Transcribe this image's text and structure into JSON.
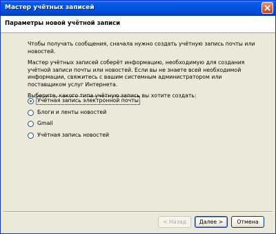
{
  "window": {
    "title": "Мастер учётных записей"
  },
  "header": {
    "title": "Параметры новой учётной записи"
  },
  "intro": {
    "p1": "Чтобы получать сообщения, сначала нужно создать учётную запись почты или новостей.",
    "p2": "Мастер учётных записей соберёт информацию, необходимую для создания учётной записи почты или новостей. Если вы не знаете всей необходимой информации, свяжитесь с вашим системным администратором или поставщиком услуг Интернета.",
    "p3": "Выберите, какого типа учётную запись вы хотите создать:"
  },
  "options": [
    {
      "label": "Учётная запись электронной почты",
      "selected": true
    },
    {
      "label": "Блоги и ленты новостей",
      "selected": false
    },
    {
      "label": "Gmail",
      "selected": false
    },
    {
      "label": "Учётная запись новостей",
      "selected": false
    }
  ],
  "buttons": {
    "back": "< Назад",
    "next": "Далее >",
    "cancel": "Отмена"
  },
  "colors": {
    "titlebar": "#0054e3",
    "background": "#ece9d8",
    "radio_dot": "#21a121"
  }
}
